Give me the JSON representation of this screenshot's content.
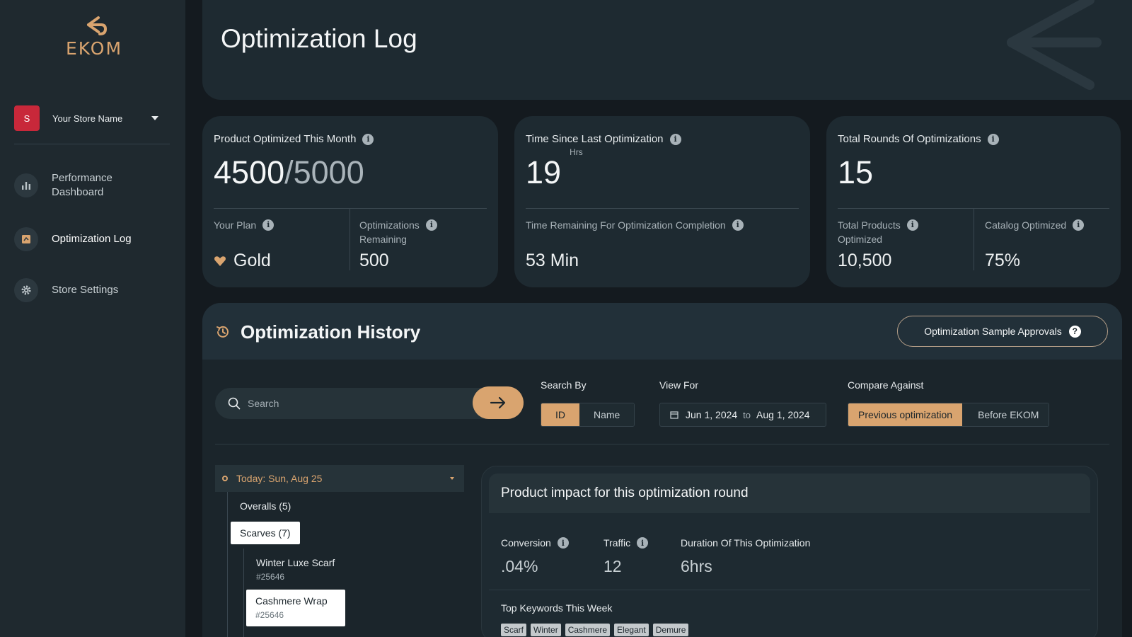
{
  "brand": {
    "name": "EKOM",
    "accent": "#d9a46f"
  },
  "store": {
    "initial": "S",
    "name": "Your Store Name"
  },
  "sidebar": {
    "items": [
      {
        "label_line1": "Performance",
        "label_line2": "Dashboard",
        "icon": "bar-chart-icon"
      },
      {
        "label": "Optimization Log",
        "icon": "log-icon"
      },
      {
        "label": "Store Settings",
        "icon": "gear-icon"
      }
    ]
  },
  "header": {
    "title": "Optimization Log"
  },
  "cards": [
    {
      "label": "Product Optimized This Month",
      "value_main": "4500",
      "value_rest": "/5000",
      "sub": [
        {
          "label": "Your Plan",
          "value": "Gold"
        },
        {
          "label_line1": "Optimizations",
          "label_line2": "Remaining",
          "value": "500"
        }
      ]
    },
    {
      "label": "Time Since Last Optimization",
      "value_main": "19",
      "unit": "Hrs",
      "sub": [
        {
          "label": "Time Remaining For Optimization Completion",
          "value": "53 Min"
        }
      ]
    },
    {
      "label": "Total Rounds Of Optimizations",
      "value_main": "15",
      "sub": [
        {
          "label_line1": "Total Products",
          "label_line2": "Optimized",
          "value": "10,500"
        },
        {
          "label": "Catalog Optimized",
          "value": "75%"
        }
      ]
    }
  ],
  "history": {
    "title": "Optimization History",
    "approvals_label": "Optimization Sample Approvals",
    "search": {
      "placeholder": "Search"
    },
    "search_by": {
      "label": "Search By",
      "options": [
        "ID",
        "Name"
      ],
      "selected": "ID"
    },
    "view_for": {
      "label": "View For",
      "from": "Jun 1, 2024",
      "to_word": "to",
      "to": "Aug 1, 2024"
    },
    "compare": {
      "label": "Compare Against",
      "options": [
        "Previous optimization",
        "Before EKOM"
      ],
      "selected": "Previous optimization"
    },
    "tree": {
      "header": "Today: Sun, Aug 25",
      "overalls": "Overalls (5)",
      "category": "Scarves (7)",
      "products": [
        {
          "name": "Winter Luxe Scarf",
          "id": "#25646"
        },
        {
          "name": "Cashmere Wrap",
          "id": "#25646"
        }
      ]
    },
    "impact": {
      "title": "Product impact for this optimization round",
      "metrics": [
        {
          "label": "Conversion",
          "value": ".04%"
        },
        {
          "label": "Traffic",
          "value": "12"
        },
        {
          "label": "Duration Of This Optimization",
          "value": "6hrs"
        }
      ],
      "keywords_label": "Top Keywords This Week",
      "keywords": [
        "Scarf",
        "Winter",
        "Cashmere",
        "Elegant",
        "Demure"
      ]
    }
  }
}
